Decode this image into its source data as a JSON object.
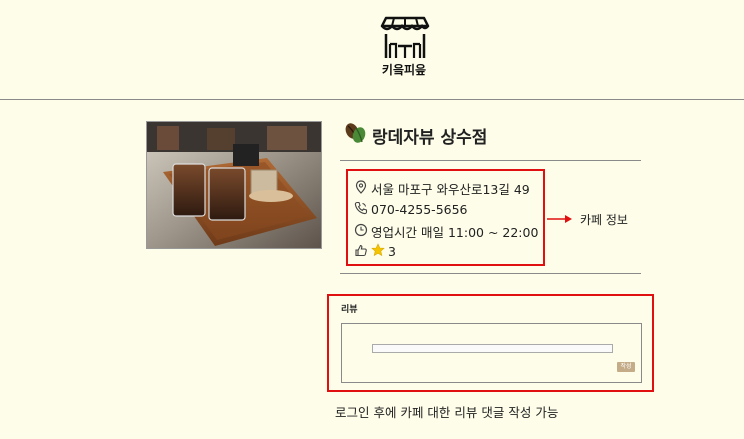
{
  "brand": {
    "name": "키읔피읖",
    "icon": "cafe-storefront-icon"
  },
  "cafe": {
    "name": "랑데자뷰 상수점",
    "title_icon": "coffee-beans-icon",
    "photo": "cafe-photo-iced-coffee",
    "address": "서울 마포구 와우산로13길 49",
    "phone": "070-4255-5656",
    "hours": "영업시간 매일 11:00 ~ 22:00",
    "rating": "3",
    "rating_value": 3
  },
  "annotations": {
    "cafe_info": "카페 정보",
    "review_note": "로그인 후에 카페 대한 리뷰 댓글 작성 가능"
  },
  "review": {
    "label": "리뷰",
    "input_value": "",
    "submit_label": "작성"
  },
  "colors": {
    "background": "#fefde9",
    "highlight": "#e01010",
    "submit": "#c4ac88",
    "star": "#f5c400"
  }
}
